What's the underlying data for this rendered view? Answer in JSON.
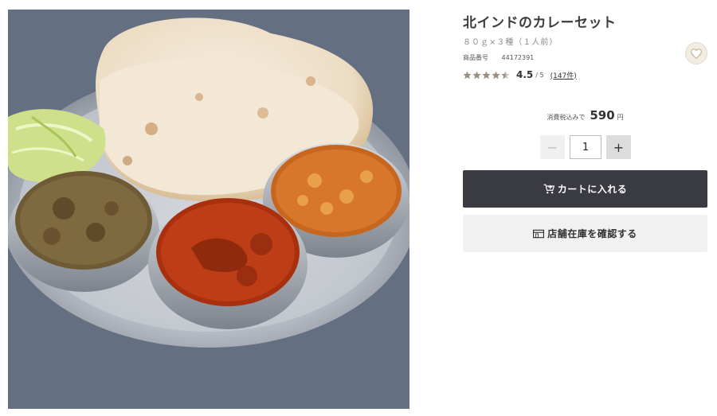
{
  "product": {
    "image_alt": "北インドのカレーセット",
    "title": "北インドのカレーセット",
    "subtitle": "８０ｇ×３種（１人前）",
    "code_label": "商品番号",
    "code_value": "44172391"
  },
  "rating": {
    "stars": 4.5,
    "value": "4.5",
    "max": "/ 5",
    "review_count": "(147件)"
  },
  "price": {
    "tax_label": "消費税込みで",
    "value": "590",
    "currency": "円"
  },
  "quantity": {
    "minus": "−",
    "value": "1",
    "plus": "+"
  },
  "actions": {
    "cart_label": "カートに入れる",
    "stock_label": "店舗在庫を確認する"
  },
  "colors": {
    "star_filled": "#9a8f7f",
    "star_empty": "#cfc8bc",
    "cart_bg": "#3a3a42",
    "fav_accent": "#c9b48f"
  }
}
